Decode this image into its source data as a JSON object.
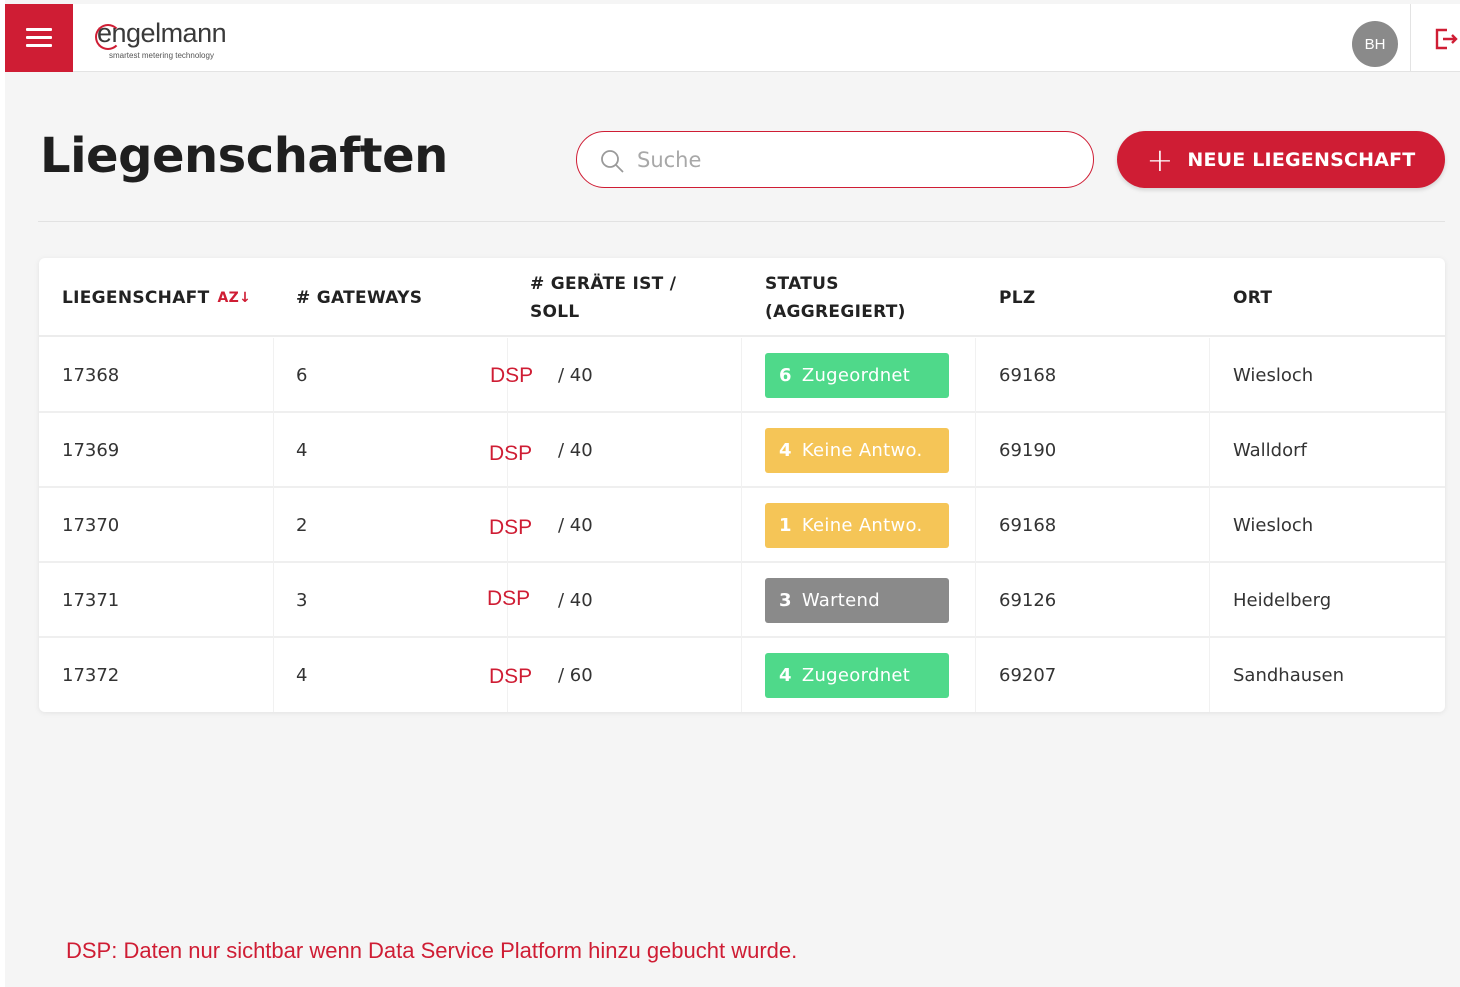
{
  "app": {
    "logo_text": "engelmann",
    "logo_tagline": "smartest metering technology",
    "user_initials": "BH",
    "colors": {
      "brand": "#cf1d34",
      "green": "#4fd98a",
      "yellow": "#f5c557",
      "gray": "#8a8a8a"
    }
  },
  "icons": {
    "menu": "hamburger-icon",
    "logout": "logout-icon",
    "search": "search-icon",
    "add": "plus-icon",
    "sort": "sort-az-icon"
  },
  "header": {
    "title": "Liegenschaften",
    "search_placeholder": "Suche",
    "new_button_plus": "+",
    "new_button_label": "NEUE LIEGENSCHAFT"
  },
  "table": {
    "columns": {
      "liegenschaft": "LIEGENSCHAFT",
      "sort_label": "AZ↓",
      "gateways": "# GATEWAYS",
      "geraete_1": "# GERÄTE IST /",
      "geraete_2": "SOLL",
      "status_1": "STATUS",
      "status_2": "(AGGREGIERT)",
      "plz": "PLZ",
      "ort": "ORT"
    },
    "rows": [
      {
        "id": "17368",
        "gateways": "6",
        "ist": "DSP",
        "soll": "/ 40",
        "status_count": "6",
        "status_label": "Zugeordnet",
        "status_color": "#4fd98a",
        "plz": "69168",
        "ort": "Wiesloch"
      },
      {
        "id": "17369",
        "gateways": "4",
        "ist": "DSP",
        "soll": "/ 40",
        "status_count": "4",
        "status_label": "Keine Antwo.",
        "status_color": "#f5c557",
        "plz": "69190",
        "ort": "Walldorf"
      },
      {
        "id": "17370",
        "gateways": "2",
        "ist": "DSP",
        "soll": "/ 40",
        "status_count": "1",
        "status_label": "Keine Antwo.",
        "status_color": "#f5c557",
        "plz": "69168",
        "ort": "Wiesloch"
      },
      {
        "id": "17371",
        "gateways": "3",
        "ist": "DSP",
        "soll": "/ 40",
        "status_count": "3",
        "status_label": "Wartend",
        "status_color": "#8a8a8a",
        "plz": "69126",
        "ort": "Heidelberg"
      },
      {
        "id": "17372",
        "gateways": "4",
        "ist": "DSP",
        "soll": "/ 60",
        "status_count": "4",
        "status_label": "Zugeordnet",
        "status_color": "#4fd98a",
        "plz": "69207",
        "ort": "Sandhausen"
      }
    ]
  },
  "footnote": "DSP: Daten nur sichtbar wenn Data Service Platform hinzu gebucht wurde."
}
